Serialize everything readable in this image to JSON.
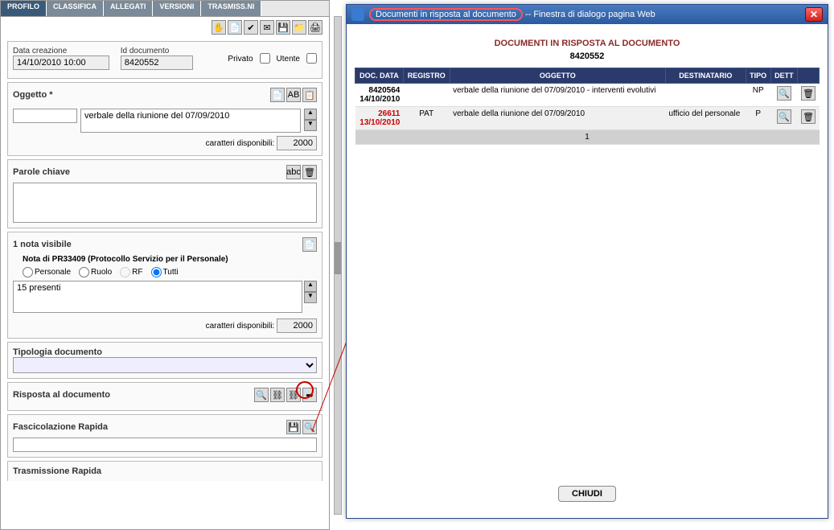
{
  "tabs": [
    "PROFILO",
    "CLASSIFICA",
    "ALLEGATI",
    "VERSIONI",
    "TRASMISS.NI"
  ],
  "creation": {
    "label": "Data creazione",
    "value": "14/10/2010 10:00"
  },
  "docid": {
    "label": "Id documento",
    "value": "8420552"
  },
  "privato": "Privato",
  "utente": "Utente",
  "oggetto": {
    "label": "Oggetto *",
    "value": "verbale della riunione del 07/09/2010"
  },
  "chars_label": "caratteri disponibili:",
  "chars_value": "2000",
  "parole": "Parole chiave",
  "nota": {
    "header": "1 nota visibile",
    "line": "Nota di PR33409 (Protocollo Servizio per il Personale)",
    "r": [
      "Personale",
      "Ruolo",
      "RF",
      "Tutti"
    ],
    "text": "15 presenti"
  },
  "tipologia": "Tipologia documento",
  "risposta": "Risposta al documento",
  "fasc": "Fascicolazione Rapida",
  "trasm": "Trasmissione Rapida",
  "dialog": {
    "title_hl": "Documenti in risposta al documento",
    "title_suffix": " -- Finestra di dialogo pagina Web",
    "heading": "DOCUMENTI IN RISPOSTA AL DOCUMENTO",
    "docnum": "8420552",
    "cols": [
      "DOC. DATA",
      "REGISTRO",
      "OGGETTO",
      "DESTINATARIO",
      "TIPO",
      "DETT",
      ""
    ],
    "rows": [
      {
        "id": "8420564",
        "date": "14/10/2010",
        "reg": "",
        "ogg": "verbale della riunione del 07/09/2010 - interventi evolutivi",
        "dest": "",
        "tipo": "NP"
      },
      {
        "id": "26611",
        "date": "13/10/2010",
        "reg": "PAT",
        "ogg": "verbale della riunione del 07/09/2010",
        "dest": "ufficio del personale",
        "tipo": "P",
        "red": true
      }
    ],
    "pager": "1",
    "close_btn": "CHIUDI"
  }
}
